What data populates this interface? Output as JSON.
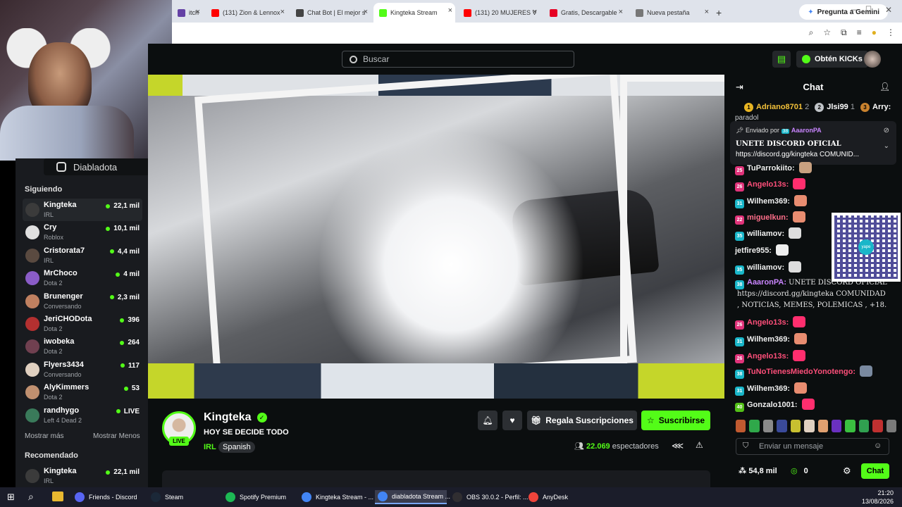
{
  "browser": {
    "tabs": [
      {
        "label": "itch",
        "color": "#6441a5"
      },
      {
        "label": "(131) Zion & Lennox",
        "color": "#ff0000"
      },
      {
        "label": "Chat Bot | El mejor s",
        "color": "#444444"
      },
      {
        "label": "Kingteka Stream",
        "color": "#53fc18",
        "active": true
      },
      {
        "label": "(131) 20 MUJERES V",
        "color": "#ff0000"
      },
      {
        "label": "Gratis, Descargable",
        "color": "#e60023"
      },
      {
        "label": "Nueva pestaña",
        "color": "#777777"
      }
    ],
    "new_tab": "+",
    "gemini_label": "Pregunta a Gemini"
  },
  "topnav": {
    "search_placeholder": "Buscar",
    "kicks_label": "Obtén KICKs"
  },
  "webcam": {
    "instagram": "Diabladota"
  },
  "sidebar": {
    "following_header": "Siguiendo",
    "channels": [
      {
        "name": "Kingteka",
        "category": "IRL",
        "viewers": "22,1 mil",
        "avatar": "#3b3b3b",
        "selected": true
      },
      {
        "name": "Cry",
        "category": "Roblox",
        "viewers": "10,1 mil",
        "avatar": "#e0e0e0"
      },
      {
        "name": "Cristorata7",
        "category": "IRL",
        "viewers": "4,4 mil",
        "avatar": "#5a4a40"
      },
      {
        "name": "MrChoco",
        "category": "Dota 2",
        "viewers": "4 mil",
        "avatar": "#8a5cc7"
      },
      {
        "name": "Brunenger",
        "category": "Conversando",
        "viewers": "2,3 mil",
        "avatar": "#c08060"
      },
      {
        "name": "JeriCHODota",
        "category": "Dota 2",
        "viewers": "396",
        "avatar": "#b33030"
      },
      {
        "name": "iwobeka",
        "category": "Dota 2",
        "viewers": "264",
        "avatar": "#704050"
      },
      {
        "name": "Flyers3434",
        "category": "Conversando",
        "viewers": "117",
        "avatar": "#e0d0c0"
      },
      {
        "name": "AlyKimmers",
        "category": "Dota 2",
        "viewers": "53",
        "avatar": "#c09070"
      },
      {
        "name": "randhygo",
        "category": "Left 4 Dead 2",
        "viewers": "LIVE",
        "avatar": "#3a7a5a"
      }
    ],
    "show_more": "Mostrar más",
    "show_less": "Mostrar Menos",
    "recommended_header": "Recomendado",
    "recommended": [
      {
        "name": "Kingteka",
        "category": "IRL",
        "viewers": "22,1 mil",
        "avatar": "#3b3b3b"
      }
    ]
  },
  "stream": {
    "streamer": "Kingteka",
    "title": "HOY SE DECIDE TODO",
    "category": "IRL",
    "language": "Spanish",
    "live_badge": "LIVE",
    "gift_label": "Regala Suscripciones",
    "subscribe_label": "Suscribirse",
    "viewers_count": "22.069",
    "viewers_label": "espectadores"
  },
  "chat": {
    "title": "Chat",
    "gifters": [
      {
        "rank": "1",
        "name": "Adriano8701",
        "count": "2"
      },
      {
        "rank": "2",
        "name": "Jlsi99",
        "count": "1"
      },
      {
        "rank": "3",
        "name": "Arry:",
        "count": ""
      }
    ],
    "partial_top": "paradol",
    "pinned": {
      "by_label": "Enviado por",
      "badge": "38",
      "user": "AaaronPA",
      "line1": "UNETE DISCORD OFICIAL",
      "line2": "https://discord.gg/kingteka COMUNID..."
    },
    "messages": [
      {
        "badge": "25",
        "bcolor": "#e0337a",
        "user": "TuParrokiito:",
        "ucolor": "#f0f0f0",
        "text": "",
        "emote": "#c8a080"
      },
      {
        "badge": "26",
        "bcolor": "#e0337a",
        "user": "Angelo13s:",
        "ucolor": "#ff4f7a",
        "text": "",
        "emote": "#ff2e6e"
      },
      {
        "badge": "31",
        "bcolor": "#19b6c9",
        "user": "Wilhem369:",
        "ucolor": "#f0f0f0",
        "text": "",
        "emote": "#e88c70"
      },
      {
        "badge": "22",
        "bcolor": "#e0337a",
        "user": "miguelkun:",
        "ucolor": "#ff6e8a",
        "text": "",
        "emote": "#e88c70"
      },
      {
        "badge": "35",
        "bcolor": "#19b6c9",
        "user": "williamov:",
        "ucolor": "#f0f0f0",
        "text": "",
        "emote": "#dddddd"
      },
      {
        "badge": "",
        "bcolor": "",
        "user": "jetfire955:",
        "ucolor": "#f0f0f0",
        "text": "",
        "emote": "#eeeeee"
      },
      {
        "badge": "35",
        "bcolor": "#19b6c9",
        "user": "williamov:",
        "ucolor": "#f0f0f0",
        "text": "",
        "emote": "#dddddd"
      },
      {
        "badge": "38",
        "bcolor": "#19b6c9",
        "user": "AaaronPA:",
        "ucolor": "#c985ff",
        "text": "UNETE DISCORD OFICIAL",
        "emote": ""
      },
      {
        "badge": "",
        "bcolor": "",
        "user": "",
        "ucolor": "#f0f0f0",
        "text": "https://discord.gg/kingteka COMUNIDAD",
        "emote": ""
      },
      {
        "badge": "",
        "bcolor": "",
        "user": "",
        "ucolor": "#f0f0f0",
        "text": ", NOTICIAS, MEMES, POLEMICAS , +18.",
        "emote": ""
      },
      {
        "badge": "26",
        "bcolor": "#e0337a",
        "user": "Angelo13s:",
        "ucolor": "#ff4f7a",
        "text": "",
        "emote": "#ff2e6e"
      },
      {
        "badge": "31",
        "bcolor": "#19b6c9",
        "user": "Wilhem369:",
        "ucolor": "#f0f0f0",
        "text": "",
        "emote": "#e88c70"
      },
      {
        "badge": "26",
        "bcolor": "#e0337a",
        "user": "Angelo13s:",
        "ucolor": "#ff4f7a",
        "text": "",
        "emote": "#ff2e6e"
      },
      {
        "badge": "38",
        "bcolor": "#19b6c9",
        "user": "TuNoTienesMiedoYonotengo:",
        "ucolor": "#ff4f7a",
        "text": "",
        "emote": "#7a8aa0"
      },
      {
        "badge": "31",
        "bcolor": "#19b6c9",
        "user": "Wilhem369:",
        "ucolor": "#f0f0f0",
        "text": "",
        "emote": "#e88c70"
      },
      {
        "badge": "40",
        "bcolor": "#53c018",
        "user": "Gonzalo1001:",
        "ucolor": "#f0f0f0",
        "text": "",
        "emote": "#ff2e6e"
      }
    ],
    "qr_label": "yape",
    "emote_colors": [
      "#c05a30",
      "#2fa84a",
      "#8a8a8a",
      "#3a4a9a",
      "#c8c030",
      "#e0d0c0",
      "#e0a070",
      "#6a30c0",
      "#3ac040",
      "#30a050",
      "#c03030",
      "#7a7a7a"
    ],
    "input_placeholder": "Enviar un mensaje",
    "balance": "54,8 mil",
    "kicks": "0",
    "send_label": "Chat"
  },
  "taskbar": {
    "items": [
      {
        "label": "Friends - Discord",
        "color": "#5865f2"
      },
      {
        "label": "Steam",
        "color": "#1b2838"
      },
      {
        "label": "Spotify Premium",
        "color": "#1db954"
      },
      {
        "label": "Kingteka Stream - ...",
        "color": "#4285f4"
      },
      {
        "label": "diabladota Stream ...",
        "color": "#4285f4",
        "active": true
      },
      {
        "label": "OBS 30.0.2 - Perfil: ...",
        "color": "#302e31"
      },
      {
        "label": "AnyDesk",
        "color": "#ef443b"
      }
    ],
    "time": "21:20",
    "date": "13/08/2026"
  }
}
